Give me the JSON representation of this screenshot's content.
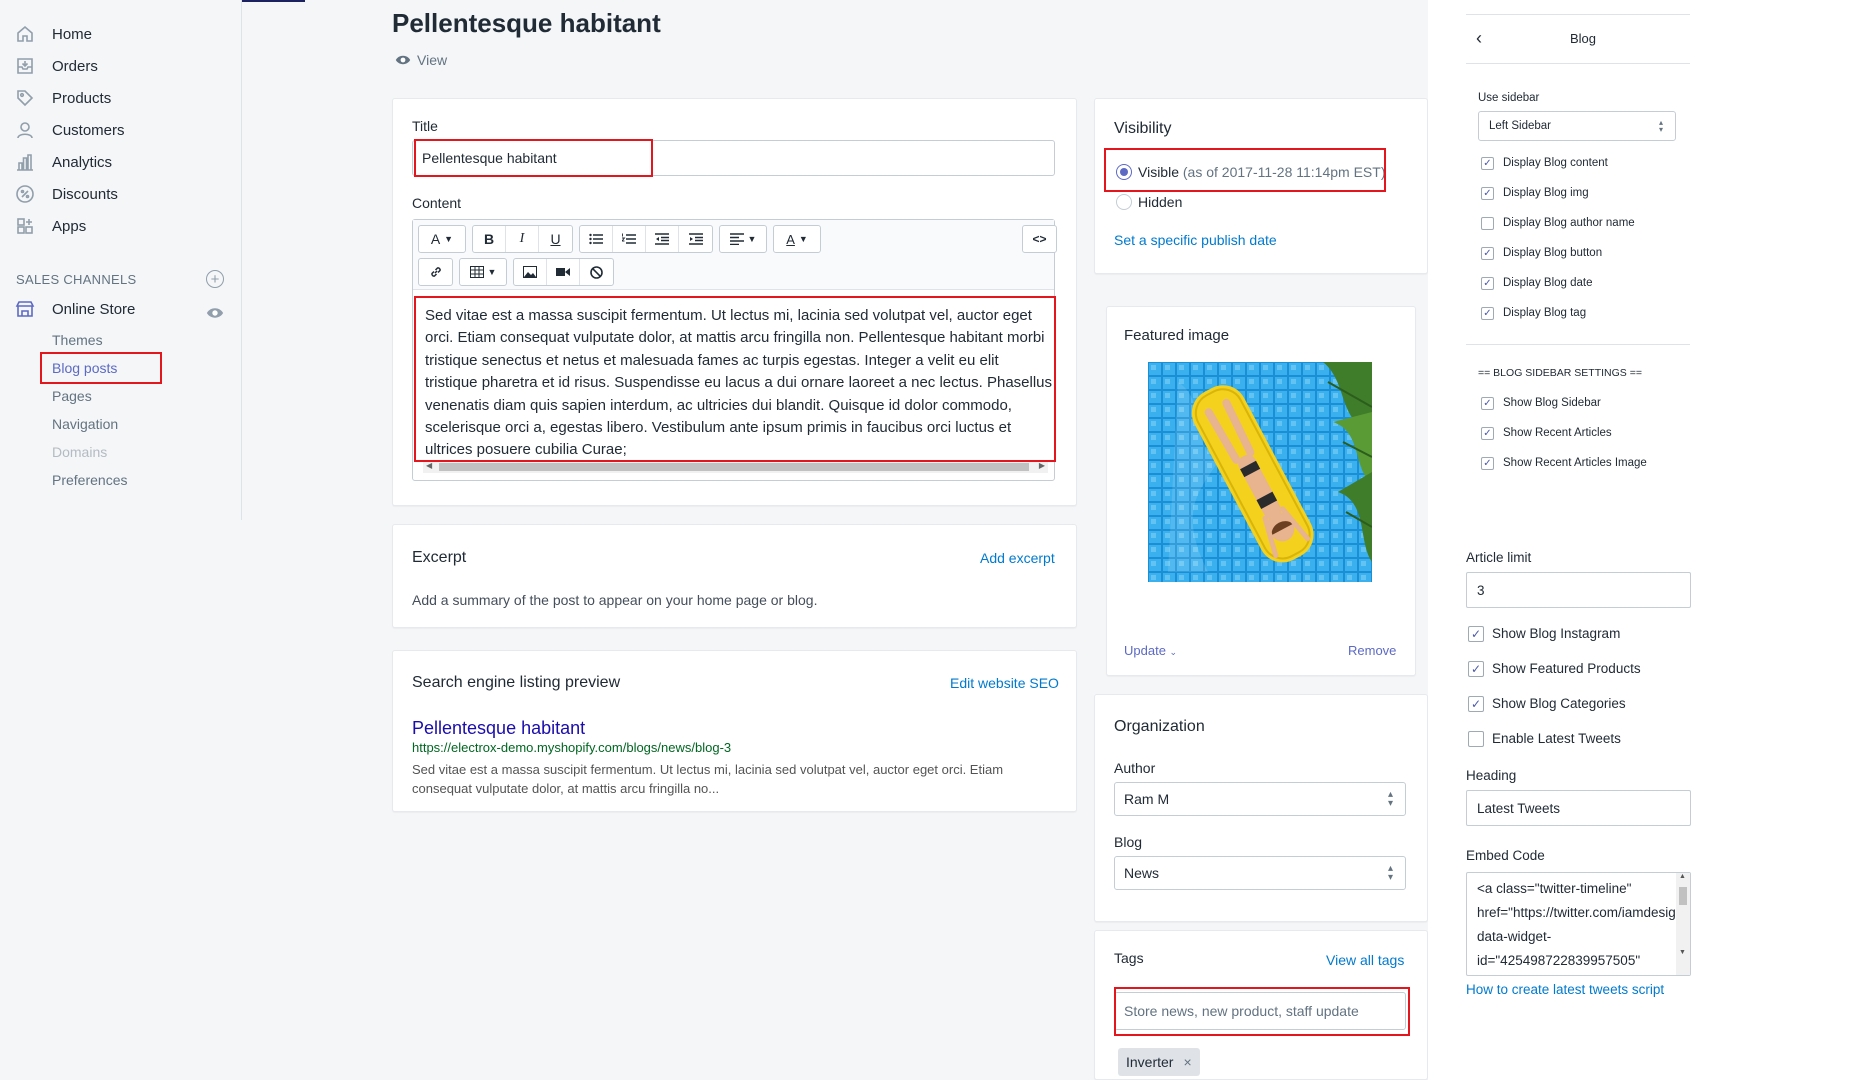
{
  "nav": {
    "items": [
      {
        "label": "Home",
        "icon": "home-icon"
      },
      {
        "label": "Orders",
        "icon": "orders-icon"
      },
      {
        "label": "Products",
        "icon": "tag-icon"
      },
      {
        "label": "Customers",
        "icon": "person-icon"
      },
      {
        "label": "Analytics",
        "icon": "bar-chart-icon"
      },
      {
        "label": "Discounts",
        "icon": "discount-icon"
      },
      {
        "label": "Apps",
        "icon": "apps-icon"
      }
    ],
    "sales_channels_label": "SALES CHANNELS",
    "online_store": "Online Store",
    "sub_items": [
      "Themes",
      "Blog posts",
      "Pages",
      "Navigation",
      "Domains",
      "Preferences"
    ]
  },
  "page": {
    "title": "Pellentesque habitant",
    "view_label": "View"
  },
  "post": {
    "title_label": "Title",
    "title_value": "Pellentesque habitant",
    "content_label": "Content",
    "content_text": "Sed vitae est a massa suscipit fermentum. Ut lectus mi, lacinia sed volutpat vel, auctor eget orci. Etiam consequat vulputate dolor, at mattis arcu fringilla non. Pellentesque habitant morbi tristique senectus et netus et malesuada fames ac turpis egestas. Integer a velit eu elit tristique pharetra et id risus. Suspendisse eu lacus a dui ornare laoreet a nec lectus. Phasellus venenatis diam quis sapien interdum, ac ultricies dui blandit. Quisque id dolor commodo, scelerisque orci a, egestas libero. Vestibulum ante ipsum primis in faucibus orci luctus et ultrices posuere cubilia Curae;",
    "toolbar": {
      "font": "A",
      "bold": "B",
      "italic": "I",
      "underline": "U",
      "color": "A",
      "html": "<>"
    }
  },
  "excerpt": {
    "title": "Excerpt",
    "add_label": "Add excerpt",
    "description": "Add a summary of the post to appear on your home page or blog."
  },
  "seo": {
    "title": "Search engine listing preview",
    "edit_label": "Edit website SEO",
    "preview_title": "Pellentesque habitant",
    "preview_url": "https://electrox-demo.myshopify.com/blogs/news/blog-3",
    "preview_desc": "Sed vitae est a massa suscipit fermentum. Ut lectus mi, lacinia sed volutpat vel, auctor eget orci. Etiam consequat vulputate dolor, at mattis arcu fringilla no..."
  },
  "visibility": {
    "title": "Visibility",
    "visible_label": "Visible",
    "visible_date": "(as of 2017-11-28 11:14pm EST)",
    "hidden_label": "Hidden",
    "publish_link": "Set a specific publish date"
  },
  "featured": {
    "title": "Featured image",
    "update_label": "Update",
    "remove_label": "Remove"
  },
  "organization": {
    "title": "Organization",
    "author_label": "Author",
    "author_value": "Ram M",
    "blog_label": "Blog",
    "blog_value": "News"
  },
  "tags": {
    "title": "Tags",
    "view_all": "View all tags",
    "placeholder": "Store news, new product, staff update",
    "chip": "Inverter"
  },
  "panel": {
    "back": "‹",
    "title": "Blog",
    "use_sidebar_label": "Use sidebar",
    "sidebar_value": "Left Sidebar",
    "checks": [
      {
        "label": "Display Blog content",
        "checked": true
      },
      {
        "label": "Display Blog img",
        "checked": true
      },
      {
        "label": "Display Blog author name",
        "checked": false
      },
      {
        "label": "Display Blog button",
        "checked": true
      },
      {
        "label": "Display Blog date",
        "checked": true
      },
      {
        "label": "Display Blog tag",
        "checked": true
      }
    ],
    "sidebar_settings_label": "== BLOG SIDEBAR SETTINGS ==",
    "sidebar_checks": [
      {
        "label": "Show Blog Sidebar",
        "checked": true
      },
      {
        "label": "Show Recent Articles",
        "checked": true
      },
      {
        "label": "Show Recent Articles Image",
        "checked": true
      }
    ],
    "article_limit_label": "Article limit",
    "article_limit_value": "3",
    "big_checks": [
      {
        "label": "Show Blog Instagram",
        "checked": true
      },
      {
        "label": "Show Featured Products",
        "checked": true
      },
      {
        "label": "Show Blog Categories",
        "checked": true
      },
      {
        "label": "Enable Latest Tweets",
        "checked": false
      }
    ],
    "heading_label": "Heading",
    "heading_value": "Latest Tweets",
    "embed_label": "Embed Code",
    "embed_value": "<a class=\"twitter-timeline\" href=\"https://twitter.com/iamdesigning\" data-widget-id=\"425498722839957505\"",
    "help_link": "How to create latest tweets script"
  },
  "colors": {
    "accent": "#5c6ac4",
    "link": "#007ace",
    "highlight": "#e3161e"
  }
}
